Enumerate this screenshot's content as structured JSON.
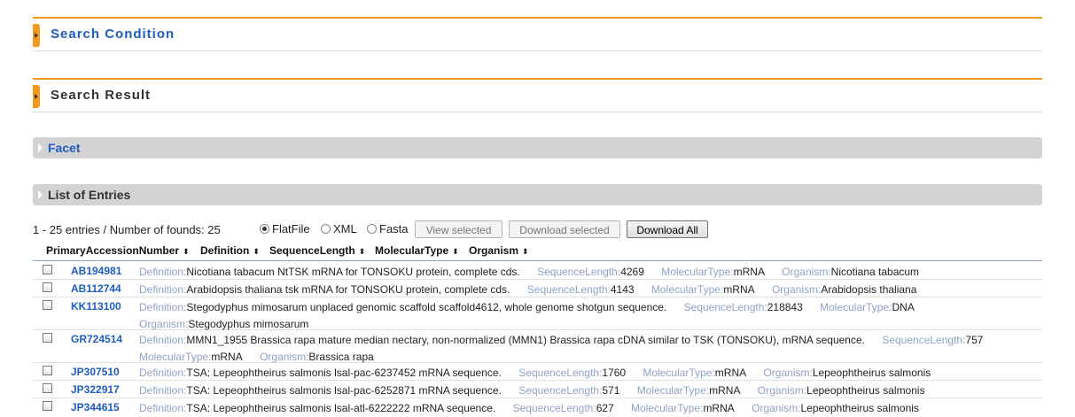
{
  "sections": {
    "search_condition": "Search Condition",
    "search_result": "Search Result"
  },
  "bars": {
    "facet": "Facet",
    "list_of_entries": "List of Entries"
  },
  "controls": {
    "found_text": "1 - 25 entries / Number of founds: 25",
    "formats": [
      {
        "label": "FlatFile",
        "selected": true
      },
      {
        "label": "XML",
        "selected": false
      },
      {
        "label": "Fasta",
        "selected": false
      }
    ],
    "view_selected": "View selected",
    "download_selected": "Download selected",
    "download_all": "Download All"
  },
  "columns": [
    "PrimaryAccessionNumber",
    "Definition",
    "SequenceLength",
    "MolecularType",
    "Organism"
  ],
  "field_labels": {
    "definition": "Definition:",
    "sequence_length": "SequenceLength:",
    "molecular_type": "MolecularType:",
    "organism": "Organism:"
  },
  "entries": [
    {
      "accession": "AB194981",
      "definition": "Nicotiana tabacum NtTSK mRNA for TONSOKU protein, complete cds.",
      "sequence_length": "4269",
      "molecular_type": "mRNA",
      "organism": "Nicotiana tabacum"
    },
    {
      "accession": "AB112744",
      "definition": "Arabidopsis thaliana tsk mRNA for TONSOKU protein, complete cds.",
      "sequence_length": "4143",
      "molecular_type": "mRNA",
      "organism": "Arabidopsis thaliana"
    },
    {
      "accession": "KK113100",
      "definition": "Stegodyphus mimosarum unplaced genomic scaffold scaffold4612, whole genome shotgun sequence.",
      "sequence_length": "218843",
      "molecular_type": "DNA",
      "organism": "Stegodyphus mimosarum"
    },
    {
      "accession": "GR724514",
      "definition": "MMN1_1955 Brassica rapa mature median nectary, non-normalized (MMN1) Brassica rapa cDNA similar to TSK (TONSOKU), mRNA sequence.",
      "sequence_length": "757",
      "molecular_type": "mRNA",
      "organism": "Brassica rapa"
    },
    {
      "accession": "JP307510",
      "definition": "TSA: Lepeophtheirus salmonis lsal-pac-6237452 mRNA sequence.",
      "sequence_length": "1760",
      "molecular_type": "mRNA",
      "organism": "Lepeophtheirus salmonis"
    },
    {
      "accession": "JP322917",
      "definition": "TSA: Lepeophtheirus salmonis lsal-pac-6252871 mRNA sequence.",
      "sequence_length": "571",
      "molecular_type": "mRNA",
      "organism": "Lepeophtheirus salmonis"
    },
    {
      "accession": "JP344615",
      "definition": "TSA: Lepeophtheirus salmonis lsal-atl-6222222 mRNA sequence.",
      "sequence_length": "627",
      "molecular_type": "mRNA",
      "organism": "Lepeophtheirus salmonis"
    }
  ]
}
